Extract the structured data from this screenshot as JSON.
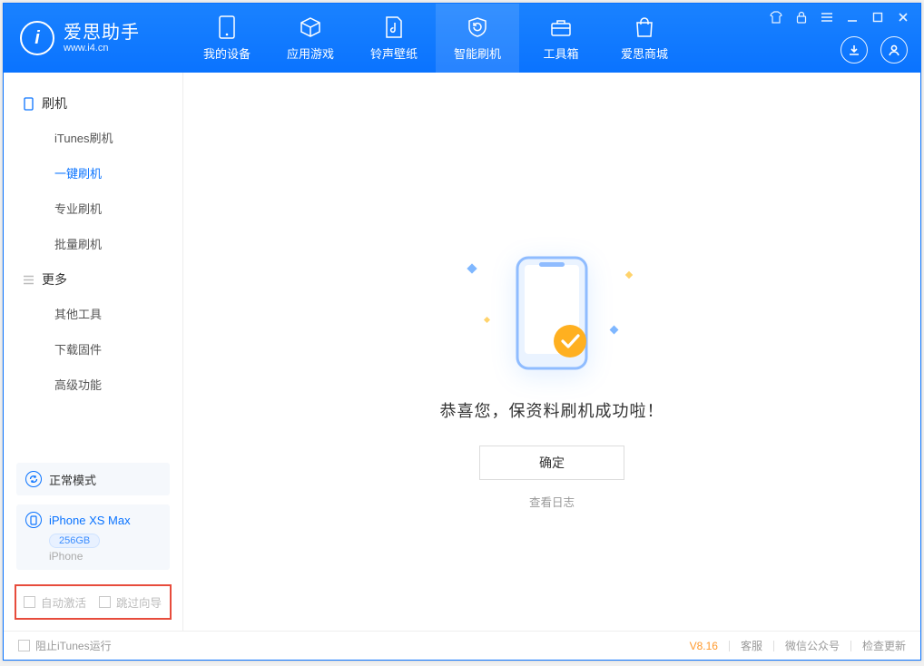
{
  "brand": {
    "title": "爱思助手",
    "subtitle": "www.i4.cn",
    "logo_letter": "i"
  },
  "nav": {
    "items": [
      {
        "label": "我的设备"
      },
      {
        "label": "应用游戏"
      },
      {
        "label": "铃声壁纸"
      },
      {
        "label": "智能刷机"
      },
      {
        "label": "工具箱"
      },
      {
        "label": "爱思商城"
      }
    ]
  },
  "sidebar": {
    "group1_title": "刷机",
    "group1_items": [
      {
        "label": "iTunes刷机"
      },
      {
        "label": "一键刷机"
      },
      {
        "label": "专业刷机"
      },
      {
        "label": "批量刷机"
      }
    ],
    "group2_title": "更多",
    "group2_items": [
      {
        "label": "其他工具"
      },
      {
        "label": "下载固件"
      },
      {
        "label": "高级功能"
      }
    ],
    "mode_label": "正常模式",
    "device": {
      "name": "iPhone XS Max",
      "storage": "256GB",
      "type": "iPhone"
    },
    "checks": {
      "auto_activate": "自动激活",
      "skip_guide": "跳过向导"
    }
  },
  "main": {
    "success_msg": "恭喜您，保资料刷机成功啦！",
    "ok_btn": "确定",
    "view_log": "查看日志"
  },
  "footer": {
    "block_itunes": "阻止iTunes运行",
    "version": "V8.16",
    "links": {
      "kefu": "客服",
      "wechat": "微信公众号",
      "update": "检查更新"
    }
  }
}
